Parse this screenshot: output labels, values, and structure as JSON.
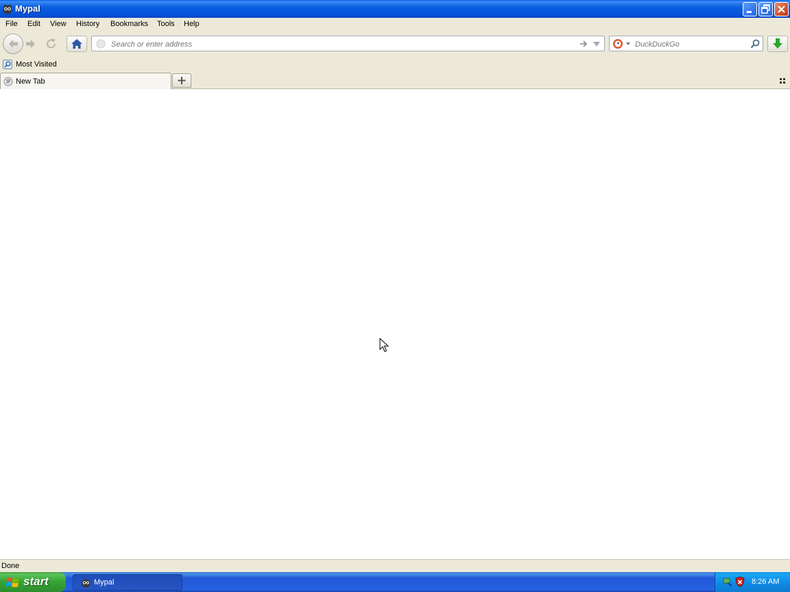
{
  "window": {
    "title": "Mypal",
    "icon": "mypal-app-icon"
  },
  "menu": [
    {
      "label": "File"
    },
    {
      "label": "Edit"
    },
    {
      "label": "View"
    },
    {
      "label": "History"
    },
    {
      "label": "Bookmarks"
    },
    {
      "label": "Tools"
    },
    {
      "label": "Help"
    }
  ],
  "nav": {
    "address_placeholder": "Search or enter address",
    "address_value": "",
    "search_engine": "DuckDuckGo",
    "search_placeholder": "DuckDuckGo"
  },
  "bookmarks": {
    "items": [
      {
        "label": "Most Visited"
      }
    ]
  },
  "tabs": [
    {
      "label": "New Tab",
      "active": true
    }
  ],
  "status": {
    "text": "Done"
  },
  "taskbar": {
    "start_label": "start",
    "items": [
      {
        "label": "Mypal"
      }
    ],
    "clock": "8:26 AM"
  },
  "colors": {
    "xp_blue": "#0550d8",
    "chrome": "#ece9d8",
    "start_green": "#36a636"
  }
}
